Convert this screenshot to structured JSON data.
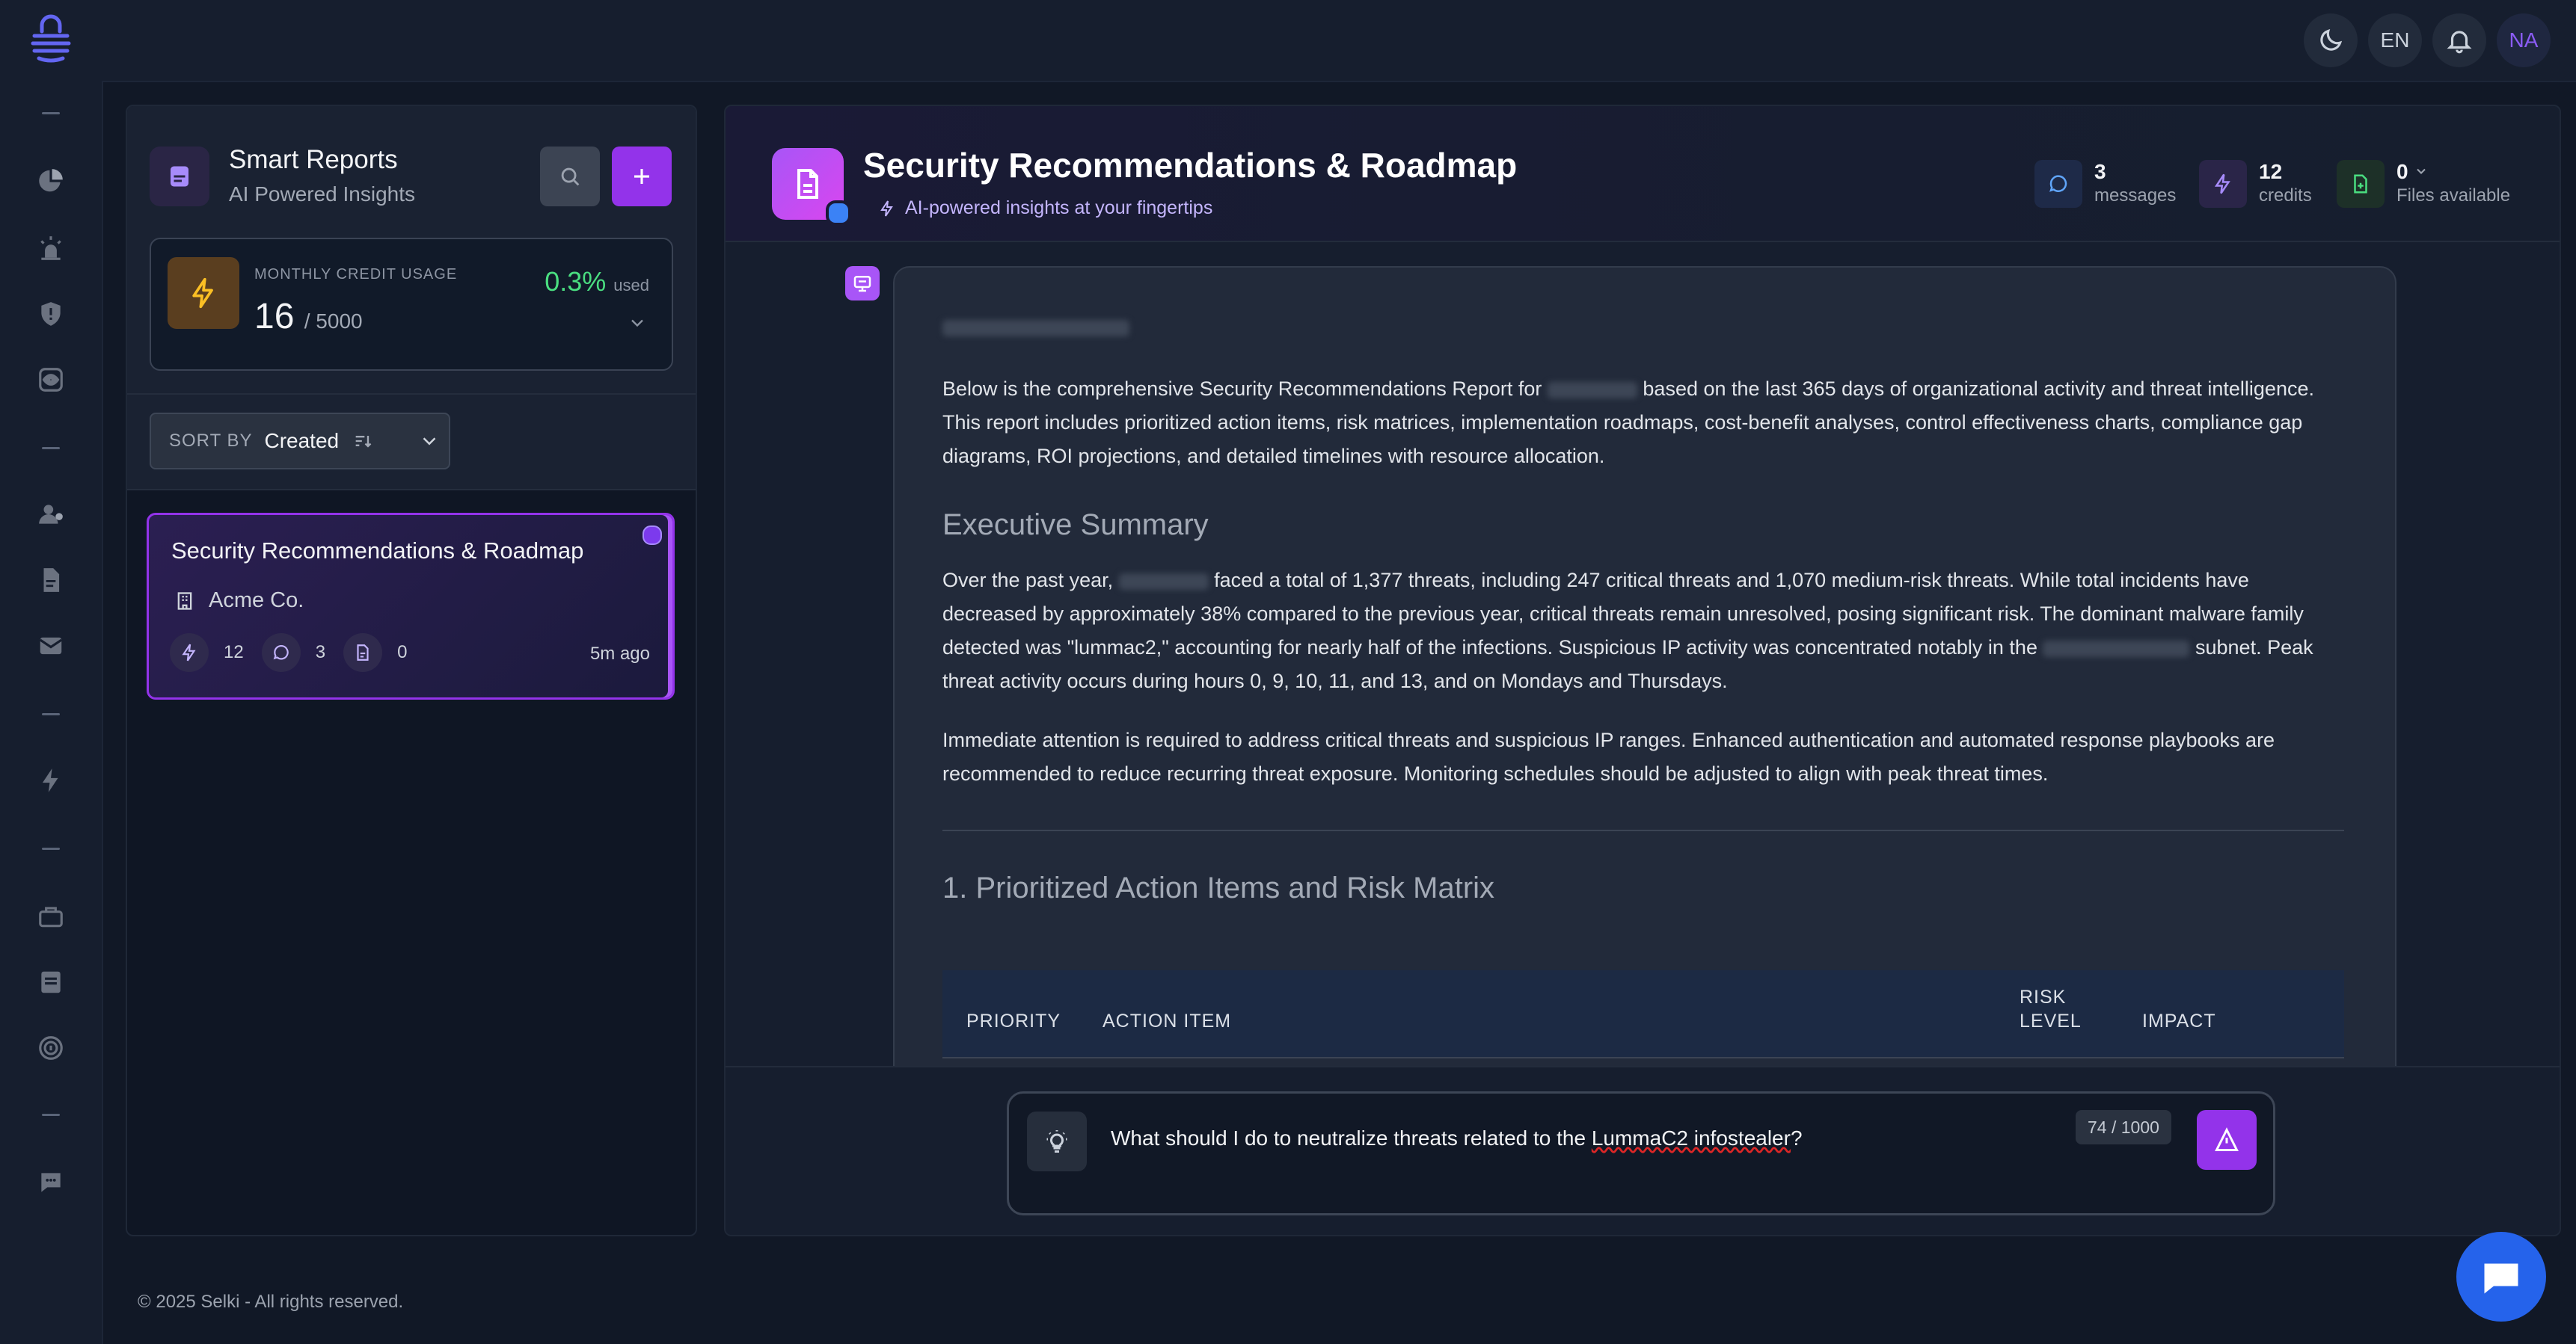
{
  "topbar": {
    "language": "EN",
    "user_initials": "NA"
  },
  "reports_panel": {
    "title": "Smart Reports",
    "subtitle": "AI Powered Insights",
    "credit_usage": {
      "label": "MONTHLY CREDIT USAGE",
      "used": "16",
      "limit": "/ 5000",
      "percent": "0.3%",
      "percent_suffix": "used"
    },
    "sort": {
      "label": "SORT BY",
      "value": "Created"
    },
    "reports": [
      {
        "title": "Security Recommendations & Roadmap",
        "company": "Acme Co.",
        "credits": "12",
        "messages": "3",
        "files": "0",
        "time": "5m ago"
      }
    ]
  },
  "report_header": {
    "title": "Security Recommendations & Roadmap",
    "subtitle": "AI-powered insights at your fingertips",
    "stats": {
      "messages_count": "3",
      "messages_label": "messages",
      "credits_count": "12",
      "credits_label": "credits",
      "files_count": "0",
      "files_label": "Files available"
    }
  },
  "message": {
    "intro_a": "Below is the comprehensive Security Recommendations Report for",
    "intro_b": "based on the last 365 days of organizational activity and threat intelligence. This report includes prioritized action items, risk matrices, implementation roadmaps, cost-benefit analyses, control effectiveness charts, compliance gap diagrams, ROI projections, and detailed timelines with resource allocation.",
    "exec_heading": "Executive Summary",
    "exec_p1_a": "Over the past year,",
    "exec_p1_b": "faced a total of 1,377 threats, including 247 critical threats and 1,070 medium-risk threats. While total incidents have decreased by approximately 38% compared to the previous year, critical threats remain unresolved, posing significant risk. The dominant malware family detected was \"lummac2,\" accounting for nearly half of the infections. Suspicious IP activity was concentrated notably in the",
    "exec_p1_c": "subnet. Peak threat activity occurs during hours 0, 9, 10, 11, and 13, and on Mondays and Thursdays.",
    "exec_p2": "Immediate attention is required to address critical threats and suspicious IP ranges. Enhanced authentication and automated response playbooks are recommended to reduce recurring threat exposure. Monitoring schedules should be adjusted to align with peak threat times.",
    "section1_heading": "1. Prioritized Action Items and Risk Matrix",
    "table_headers": {
      "priority": "PRIORITY",
      "action_item": "ACTION ITEM",
      "risk_level_1": "RISK",
      "risk_level_2": "LEVEL",
      "impact": "IMPACT"
    }
  },
  "composer": {
    "text_before": "What should I do to neutralize threats related to the ",
    "text_flagged": "LummaC2 infostealer",
    "text_after": "?",
    "char_count": "74 / 1000"
  },
  "footer": {
    "copyright": "© 2025 Selki - All rights reserved."
  },
  "colors": {
    "accent": "#9333ea",
    "credit_percent": "#4ade80",
    "chat_fab": "#2563eb"
  }
}
